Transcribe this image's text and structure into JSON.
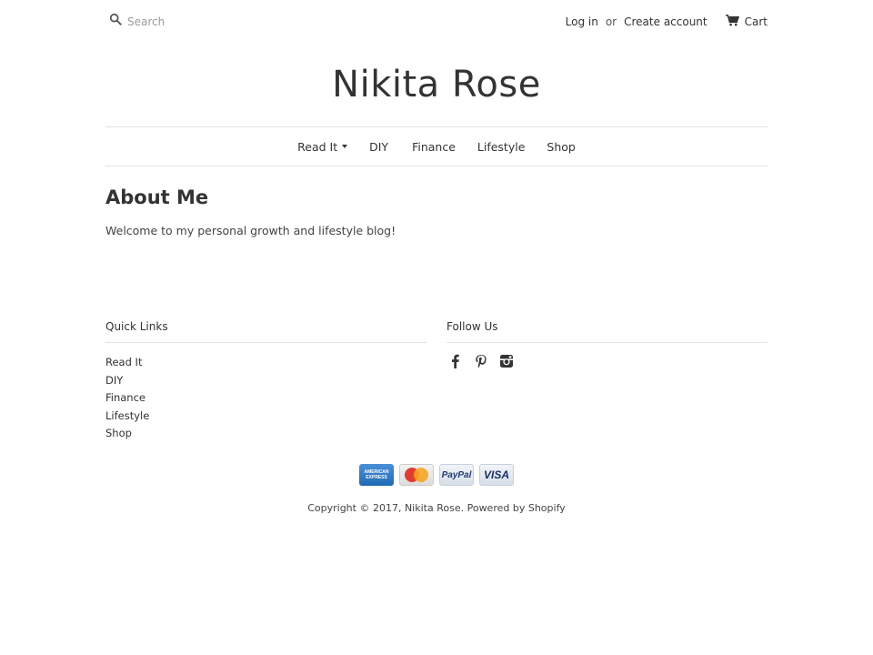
{
  "header": {
    "search_placeholder": "Search",
    "login_label": "Log in",
    "or_label": "or",
    "create_account_label": "Create account",
    "cart_label": "Cart"
  },
  "site": {
    "title": "Nikita Rose"
  },
  "nav": {
    "items": [
      {
        "label": "Read It",
        "dropdown": true
      },
      {
        "label": "DIY"
      },
      {
        "label": "Finance"
      },
      {
        "label": "Lifestyle"
      },
      {
        "label": "Shop"
      }
    ]
  },
  "page": {
    "title": "About Me",
    "body": "Welcome to my personal growth and lifestyle blog!"
  },
  "footer": {
    "quick_links_title": "Quick Links",
    "quick_links": [
      "Read It",
      "DIY",
      "Finance",
      "Lifestyle",
      "Shop"
    ],
    "follow_title": "Follow Us",
    "social_icons": [
      "facebook-icon",
      "pinterest-icon",
      "instagram-icon"
    ],
    "payment_methods": [
      {
        "name": "american-express-icon",
        "label": "AMERICAN EXPRESS"
      },
      {
        "name": "mastercard-icon",
        "label": "MasterCard"
      },
      {
        "name": "paypal-icon",
        "label": "PayPal"
      },
      {
        "name": "visa-icon",
        "label": "VISA"
      }
    ],
    "copyright_text": "Copyright © 2017,",
    "copyright_owner": "Nikita Rose",
    "powered_by": "Powered by Shopify"
  }
}
